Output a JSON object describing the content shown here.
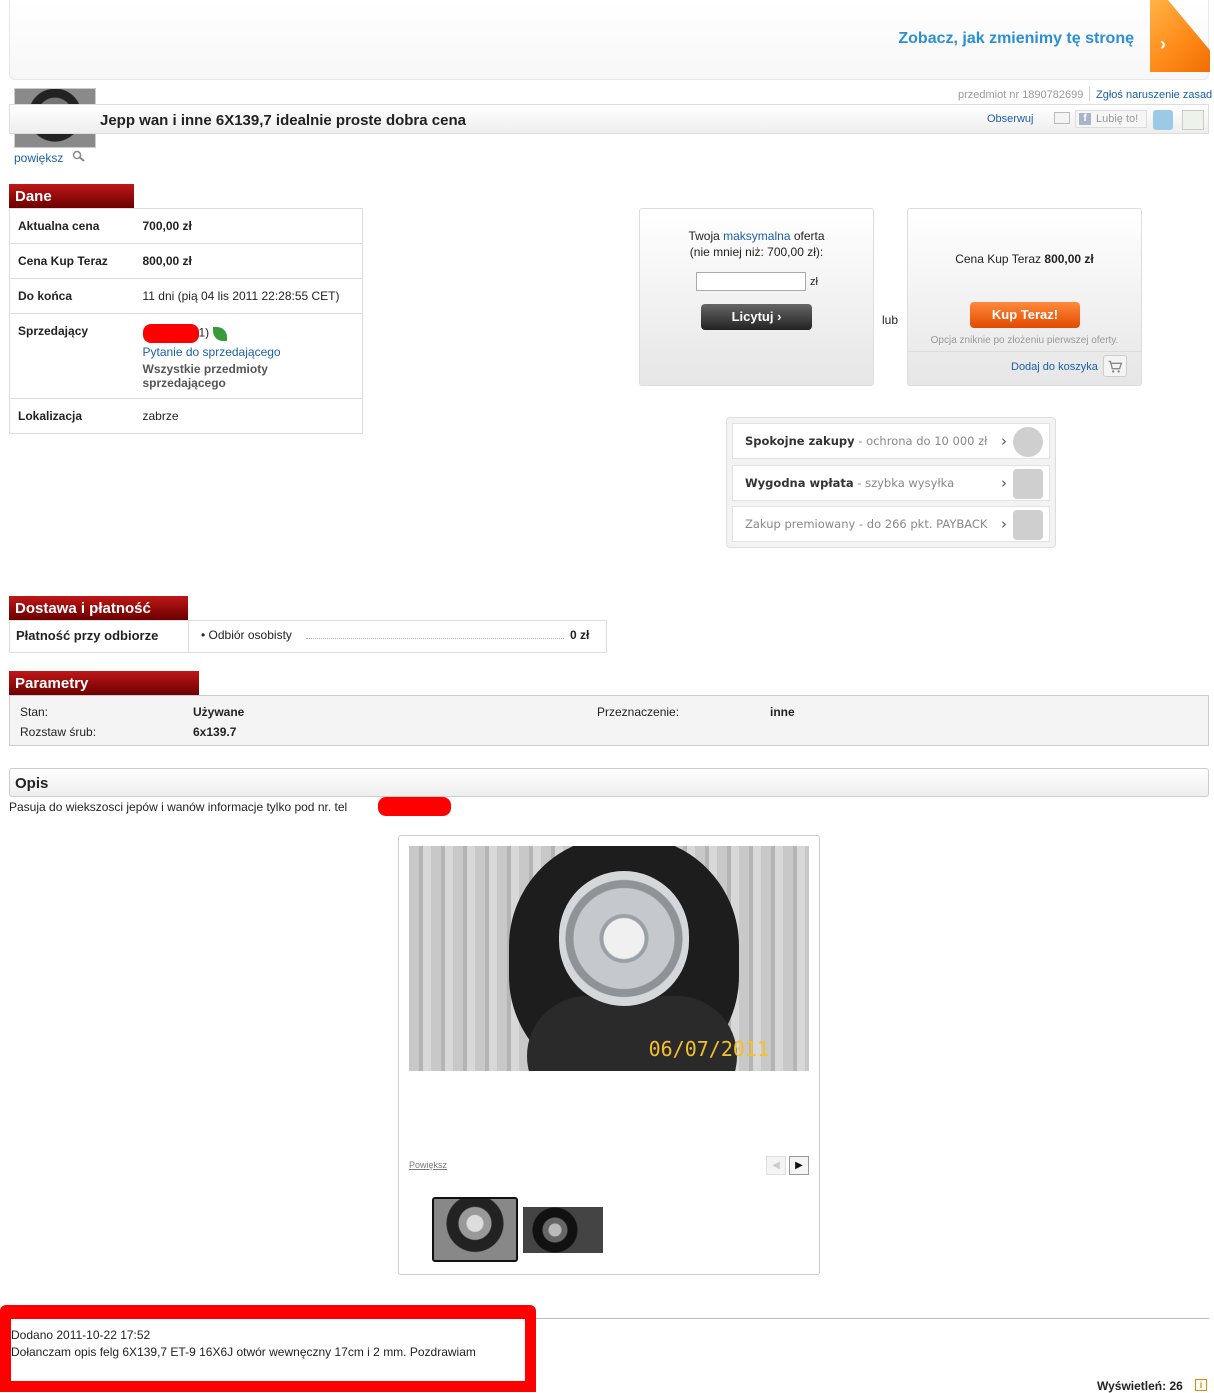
{
  "banner": {
    "link_text": "Zobacz, jak zmienimy tę stronę"
  },
  "header": {
    "enlarge": "powiększ",
    "item_number": "przedmiot nr 1890782699",
    "report": "Zgłoś naruszenie zasad",
    "title": "Jepp wan i inne 6X139,7 idealnie proste dobra cena",
    "observe": "Obserwuj",
    "like": "Lubię to!"
  },
  "sections": {
    "dane": "Dane",
    "dostawa": "Dostawa i płatność",
    "parametry": "Parametry",
    "opis": "Opis"
  },
  "dane": {
    "rows": [
      {
        "label": "Aktualna cena",
        "value": "700,00 zł"
      },
      {
        "label": "Cena Kup Teraz",
        "value": "800,00 zł"
      },
      {
        "label": "Do końca",
        "value": "11 dni (pią 04 lis 2011 22:28:55 CET)"
      },
      {
        "label": "Sprzedający",
        "value": "1)"
      },
      {
        "label": "Lokalizacja",
        "value": "zabrze"
      }
    ],
    "seller_question": "Pytanie do sprzedającego",
    "seller_all_items": "Wszystkie przedmioty sprzedającego"
  },
  "bid": {
    "line1_a": "Twoja ",
    "line1_link": "maksymalna",
    "line1_b": " oferta",
    "line2": "(nie mniej niż: 700,00 zł):",
    "input_value": "",
    "currency": "zł",
    "button": "Licytuj ›",
    "or": "lub"
  },
  "buy_now": {
    "price_label": "Cena Kup Teraz ",
    "price_value": "800,00 zł",
    "button": "Kup Teraz!",
    "note": "Opcja zniknie po złożeniu pierwszej oferty.",
    "cart": "Dodaj do koszyka"
  },
  "promo": [
    {
      "bold": "Spokojne zakupy",
      "rest": " - ochrona do 10 000 zł"
    },
    {
      "bold": "Wygodna wpłata",
      "rest": " - szybka wysyłka"
    },
    {
      "bold": "",
      "rest": "Zakup premiowany - do 266 pkt. PAYBACK"
    }
  ],
  "dostawa": {
    "label": "Płatność przy odbiorze",
    "option": "•  Odbiór osobisty",
    "price": "0 zł"
  },
  "parametry": {
    "stan_label": "Stan:",
    "stan_value": "Używane",
    "rozstaw_label": "Rozstaw śrub:",
    "rozstaw_value": "6x139.7",
    "przezn_label": "Przeznaczenie:",
    "przezn_value": "inne"
  },
  "opis": {
    "text": "Pasuja do wiekszosci jepów i wanów informacje tylko pod nr. tel",
    "photo_date": "06/07/2011",
    "enlarge": "Powiększ"
  },
  "footer": {
    "added": "Dodano 2011-10-22 17:52",
    "added_text": "Dołanczam opis felg 6X139,7 ET-9 16X6J otwór wewnęczny 17cm i 2 mm. Pozdrawiam",
    "views": "Wyświetleń: 26"
  }
}
